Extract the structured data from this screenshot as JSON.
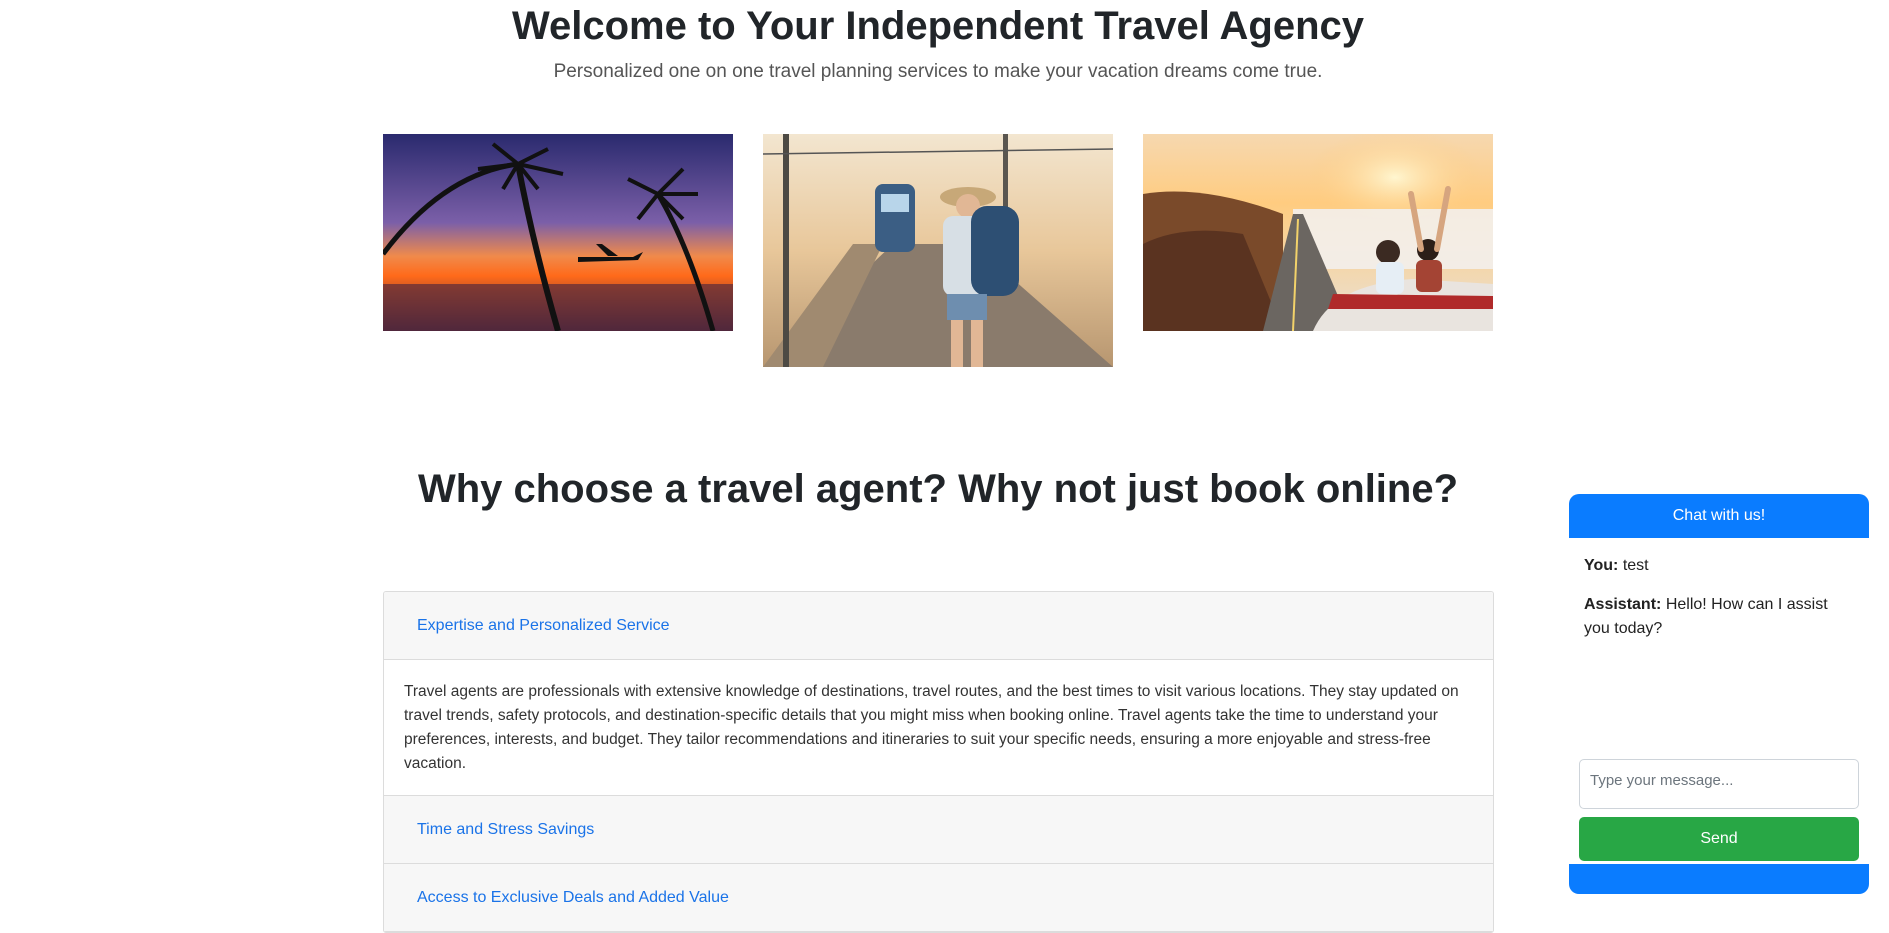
{
  "hero": {
    "title": "Welcome to Your Independent Travel Agency",
    "subtitle": "Personalized one on one travel planning services to make your vacation dreams come true."
  },
  "photos": [
    {
      "name": "sunset-palms-airplane-photo"
    },
    {
      "name": "backpacker-train-platform-photo"
    },
    {
      "name": "convertible-road-trip-photo"
    }
  ],
  "why": {
    "title": "Why choose a travel agent? Why not just book online?"
  },
  "accordion": {
    "items": [
      {
        "label": "Expertise and Personalized Service",
        "body": "Travel agents are professionals with extensive knowledge of destinations, travel routes, and the best times to visit various locations. They stay updated on travel trends, safety protocols, and destination-specific details that you might miss when booking online. Travel agents take the time to understand your preferences, interests, and budget. They tailor recommendations and itineraries to suit your specific needs, ensuring a more enjoyable and stress-free vacation."
      },
      {
        "label": "Time and Stress Savings"
      },
      {
        "label": "Access to Exclusive Deals and Added Value"
      }
    ]
  },
  "chat": {
    "header": "Chat with us!",
    "messages": [
      {
        "sender": "You:",
        "text": "test"
      },
      {
        "sender": "Assistant:",
        "text": "Hello! How can I assist you today?"
      }
    ],
    "input_placeholder": "Type your message...",
    "send_label": "Send",
    "accent_color": "#0a7cff",
    "send_color": "#28a745"
  }
}
